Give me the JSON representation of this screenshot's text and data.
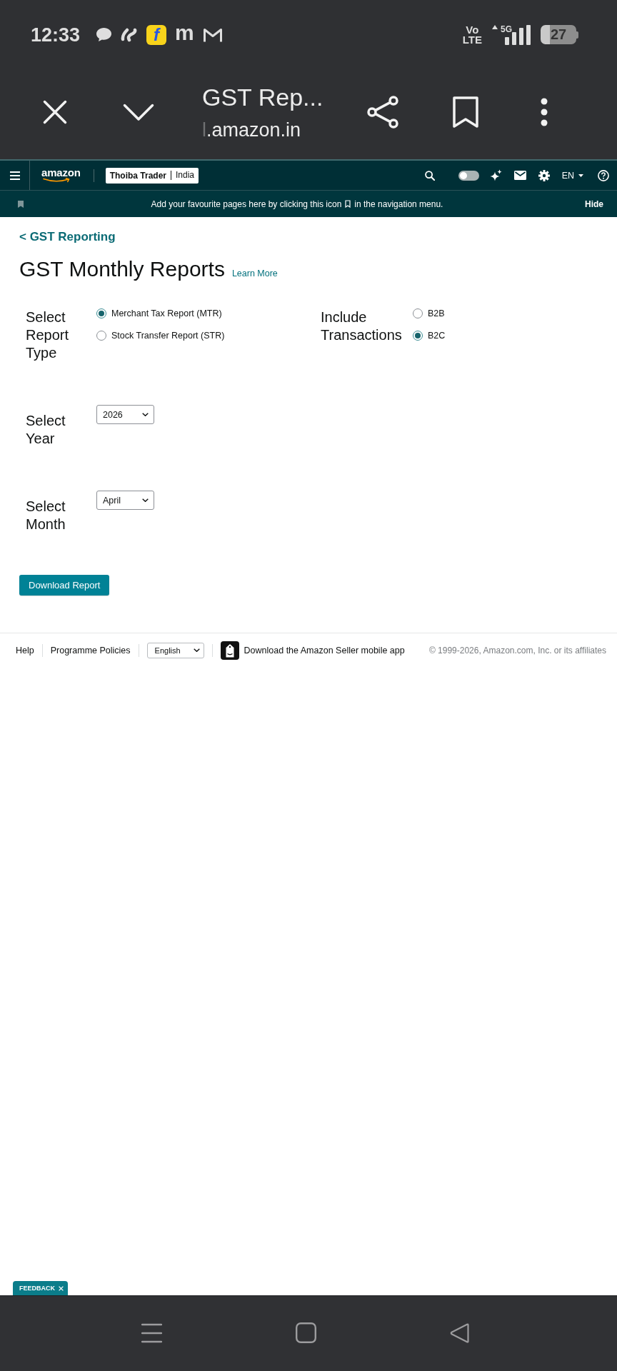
{
  "status_bar": {
    "time": "12:33",
    "notification_icons": [
      {
        "kind": "bubble"
      },
      {
        "kind": "swirl"
      },
      {
        "kind": "tile",
        "glyph": "f"
      },
      {
        "kind": "letter",
        "glyph": "m"
      },
      {
        "kind": "mail"
      }
    ],
    "volte": [
      "Vo",
      "LTE"
    ],
    "network": "5G",
    "battery": "27"
  },
  "browser_bar": {
    "title": "GST Rep...",
    "url_faded": "l",
    "url": ".amazon.in"
  },
  "nav": {
    "logo": "amazon",
    "account": {
      "name": "Thoiba Trader",
      "marketplace": "India"
    },
    "toggle": {
      "on": false
    },
    "language": "EN"
  },
  "banner": {
    "text_before": "Add your favourite pages here by clicking this icon",
    "text_after": "in the navigation menu.",
    "hide": "Hide"
  },
  "page": {
    "breadcrumb": "< GST Reporting",
    "title": "GST Monthly Reports",
    "learn_more": "Learn More"
  },
  "form": {
    "report_type": {
      "label": "Select Report Type",
      "options": [
        {
          "label": "Merchant Tax Report (MTR)",
          "selected": true
        },
        {
          "label": "Stock Transfer Report (STR)",
          "selected": false
        }
      ]
    },
    "transactions": {
      "label": "Include Transactions",
      "options": [
        {
          "label": "B2B",
          "selected": false
        },
        {
          "label": "B2C",
          "selected": true
        }
      ]
    },
    "year": {
      "label": "Select Year",
      "value": "2026"
    },
    "month": {
      "label": "Select Month",
      "value": "April"
    },
    "submit": "Download Report"
  },
  "footer": {
    "links": [
      "Help",
      "Programme Policies"
    ],
    "language": "English",
    "app_promo": "Download the Amazon Seller mobile app",
    "copyright": "© 1999-2026, Amazon.com, Inc. or its affiliates"
  },
  "feedback": {
    "label": "FEEDBACK"
  }
}
